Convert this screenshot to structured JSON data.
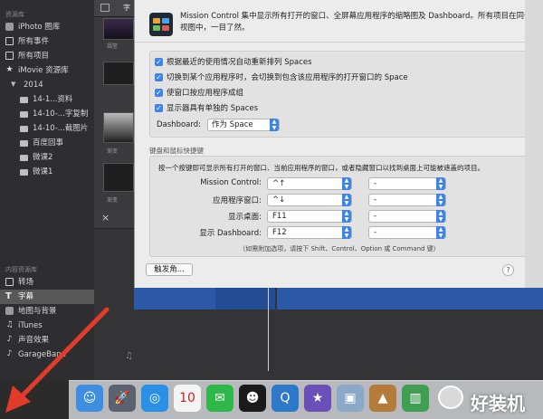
{
  "sidebar": {
    "section1_header": "资源库",
    "items": [
      {
        "label": "iPhoto 图库",
        "icon": "photo-library-icon"
      },
      {
        "label": "所有事件",
        "icon": "events-icon"
      },
      {
        "label": "所有项目",
        "icon": "projects-icon"
      },
      {
        "label": "iMovie 资源库",
        "icon": "star-icon"
      },
      {
        "label": "2014",
        "icon": "disclosure-triangle-icon"
      },
      {
        "label": "14-1...资料",
        "icon": "event-icon"
      },
      {
        "label": "14-10-...字复制",
        "icon": "event-icon"
      },
      {
        "label": "14-10-...截图片",
        "icon": "event-icon"
      },
      {
        "label": "百度回事",
        "icon": "event-icon"
      },
      {
        "label": "微课2",
        "icon": "event-icon"
      },
      {
        "label": "微课1",
        "icon": "event-icon"
      }
    ],
    "section2_header": "内容资源库",
    "content_items": [
      {
        "label": "转场",
        "icon": "transitions-icon"
      },
      {
        "label": "字幕",
        "icon": "titles-icon",
        "selected": true
      },
      {
        "label": "地图与背景",
        "icon": "maps-icon"
      },
      {
        "label": "iTunes",
        "icon": "music-note-icon"
      },
      {
        "label": "声音效果",
        "icon": "sound-effects-icon"
      },
      {
        "label": "GarageBand",
        "icon": "guitar-icon"
      }
    ]
  },
  "library": {
    "tab_label": "字",
    "thumb_captions": [
      "福堂",
      "渐变",
      "渐变"
    ]
  },
  "prefs": {
    "description": "Mission Control 集中显示所有打开的窗口、全屏幕应用程序的缩略图及 Dashboard。所有项目在同一视图中，一目了然。",
    "options": [
      {
        "label": "根据最近的使用情况自动重新排列 Spaces",
        "checked": true
      },
      {
        "label": "切换到某个应用程序时，会切换到包含该应用程序的打开窗口的 Space",
        "checked": true
      },
      {
        "label": "使窗口按应用程序成组",
        "checked": true
      },
      {
        "label": "显示器具有单独的 Spaces",
        "checked": true
      }
    ],
    "dashboard_label": "Dashboard:",
    "dashboard_value": "作为 Space",
    "shortcut_section_title": "键盘和鼠标快捷键",
    "shortcut_desc": "按一个按键即可显示所有打开的窗口、当前应用程序的窗口，或者隐藏窗口以找到桌面上可能被遮盖的项目。",
    "shortcuts": [
      {
        "label": "Mission Control:",
        "key": "^↑",
        "mouse": "-"
      },
      {
        "label": "应用程序窗口:",
        "key": "^↓",
        "mouse": "-"
      },
      {
        "label": "显示桌面:",
        "key": "F11",
        "mouse": "-"
      },
      {
        "label": "显示 Dashboard:",
        "key": "F12",
        "mouse": "-"
      }
    ],
    "modifier_hint": "（如需附加选项，请按下 Shift、Control、Option 或 Command 键）",
    "hot_corners_label": "触发角...",
    "help_label": "?"
  },
  "dock": {
    "items": [
      {
        "name": "finder-icon",
        "glyph": "☺",
        "color": "#3d8de0"
      },
      {
        "name": "launchpad-icon",
        "glyph": "🚀",
        "color": "#5a6270"
      },
      {
        "name": "safari-icon",
        "glyph": "◎",
        "color": "#2a8fe6"
      },
      {
        "name": "calendar-icon",
        "glyph": "10",
        "color": "#f4f4f4"
      },
      {
        "name": "wechat-icon",
        "glyph": "✉",
        "color": "#2eb84a"
      },
      {
        "name": "qq-icon",
        "glyph": "☻",
        "color": "#1a1a1a"
      },
      {
        "name": "quicktime-icon",
        "glyph": "Q",
        "color": "#2d79c9"
      },
      {
        "name": "imovie-icon",
        "glyph": "★",
        "color": "#6b4fb8"
      },
      {
        "name": "preview-icon",
        "glyph": "▣",
        "color": "#8aa9c9"
      },
      {
        "name": "keynote-icon",
        "glyph": "▲",
        "color": "#b47b3b"
      },
      {
        "name": "numbers-icon",
        "glyph": "▥",
        "color": "#3f9e4f"
      }
    ]
  },
  "watermark": {
    "text": "好装机"
  }
}
